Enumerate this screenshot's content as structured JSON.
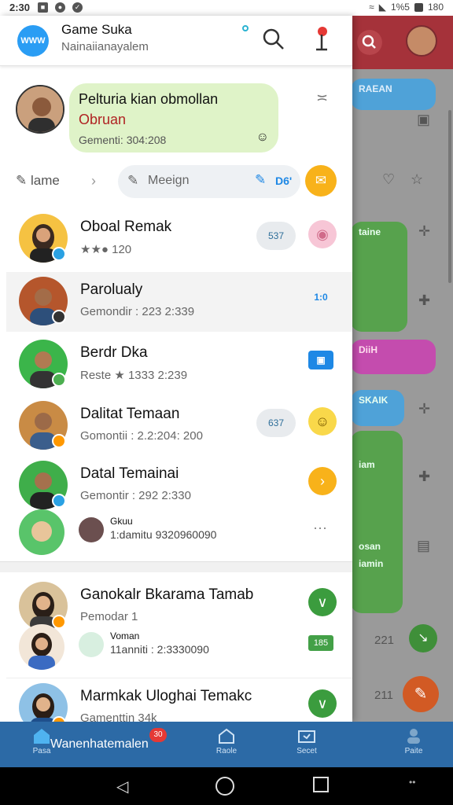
{
  "status_bar": {
    "time": "2:30",
    "battery": "180",
    "signal": "1%5"
  },
  "background_app": {
    "blue_bubble": "RAEAN",
    "green_bubble": "taine",
    "pink_bubble": "DiiH",
    "blue_bubble_2": "SKAIK",
    "green_bubble_2": "iam",
    "green_bubble_3": "osan",
    "green_bubble_4": "iamin",
    "count_1": "221",
    "count_2": "211"
  },
  "header": {
    "logo_text": "WWW",
    "title": "Game Suka",
    "subtitle": "Nainaiianayalem"
  },
  "banner": {
    "title": "Pelturia kian obmollan",
    "subtitle": "Obruan",
    "meta": "Gementi: 304:208"
  },
  "action_row": {
    "edit_label": "lame",
    "field_placeholder": "Meeign",
    "field_count": "D6'"
  },
  "chats": [
    {
      "name": "Oboal Remak",
      "preview": "120",
      "pill": "537",
      "sticker": "pig"
    },
    {
      "name": "Parolualy",
      "preview": "Gemondir : 223 2:339",
      "tag": "1:0"
    },
    {
      "name": "Berdr Dka",
      "preview": "Reste ★ 1333 2:239",
      "tag": ""
    },
    {
      "name": "Dalitat Temaan",
      "preview": "Gomontii : 2.2:204: 200",
      "pill": "637",
      "sticker": "bear"
    },
    {
      "name": "Datal Temainai",
      "preview": "Gemontir : 292 2:330"
    }
  ],
  "sub_item": {
    "name": "Gkuu",
    "meta": "1:damitu 9320960090"
  },
  "chats_2": [
    {
      "name": "Ganokalr Bkarama Tamab",
      "preview": "Pemodar 1"
    },
    {
      "name": "Marmkak Uloghai Temakc",
      "preview": "Gamenttin 34k"
    }
  ],
  "sub_item_2": {
    "name": "Voman",
    "meta": "11anniti : 2:3330090",
    "tag": "185"
  },
  "bottom_nav": {
    "home_label": "Pasa",
    "home_title": "Wanenhatemalen",
    "badge": "30",
    "item2_label": "Raole",
    "item3_label": "Secet",
    "item4_label": "Paite"
  }
}
